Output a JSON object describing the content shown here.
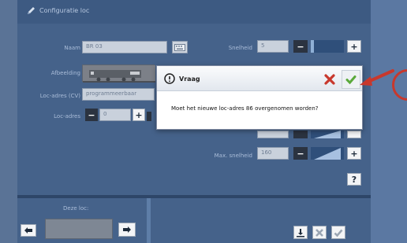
{
  "header": {
    "title": "Configuratie loc",
    "icon": "pencil-icon"
  },
  "form": {
    "fields": [
      {
        "label": "Naam",
        "value": "BR 03"
      },
      {
        "label": "Afbeelding",
        "value": ""
      },
      {
        "label": "Loc-adres (CV)",
        "value": "programmeerbaar"
      },
      {
        "label": "Loc-adres",
        "value": "0"
      }
    ],
    "right_fields": [
      {
        "label": "Snelheid",
        "value": "5"
      },
      {
        "label": "Max. snelheid",
        "value": "160"
      }
    ]
  },
  "dialog": {
    "title": "Vraag",
    "message": "Moet het nieuwe loc-adres 86 overgenomen worden?",
    "cancel_icon": "close-icon",
    "confirm_icon": "check-icon"
  },
  "lower": {
    "label": "Deze loc:"
  },
  "buttons": {
    "minus": "−",
    "plus": "+",
    "help": "?"
  },
  "colors": {
    "accent_red": "#c8382c",
    "confirm_green": "#5aa93a",
    "panel_bg": "#45628a"
  }
}
